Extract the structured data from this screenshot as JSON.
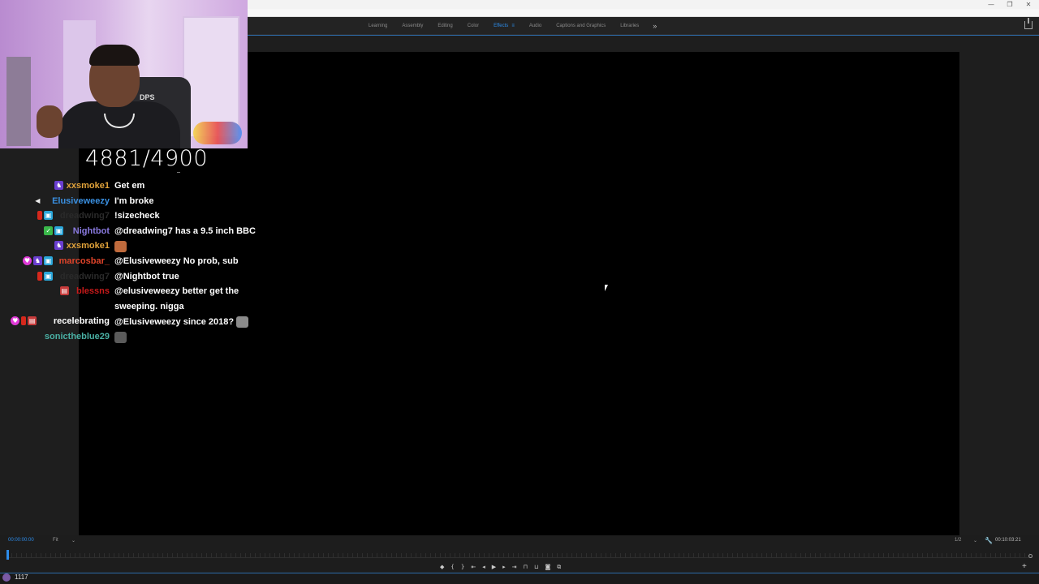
{
  "window": {
    "controls": {
      "minimize": "—",
      "maximize": "❐",
      "close": "✕"
    }
  },
  "workspace": {
    "tabs": [
      {
        "label": "Learning",
        "active": false
      },
      {
        "label": "Assembly",
        "active": false
      },
      {
        "label": "Editing",
        "active": false
      },
      {
        "label": "Color",
        "active": false
      },
      {
        "label": "Effects",
        "active": true
      },
      {
        "label": "Audio",
        "active": false
      },
      {
        "label": "Captions and Graphics",
        "active": false
      },
      {
        "label": "Libraries",
        "active": false
      }
    ],
    "menu_glyph": "≡",
    "more_glyph": "»"
  },
  "overlay": {
    "counter": "4881/4900"
  },
  "chat": {
    "messages": [
      {
        "user": "xxsmoke1",
        "color": "#e0a23a",
        "badges": [
          "purple"
        ],
        "text": "Get em",
        "emote": ""
      },
      {
        "user": "Elusiveweezy",
        "color": "#3a8fe0",
        "badges": [
          "mute"
        ],
        "text": "I'm broke",
        "emote": ""
      },
      {
        "user": "dreadwing7",
        "color": "#2a2a2a",
        "badges": [
          "red",
          "cyan"
        ],
        "text": "!sizecheck",
        "emote": ""
      },
      {
        "user": "Nightbot",
        "color": "#8a7ae0",
        "badges": [
          "green",
          "cyan"
        ],
        "text": "@dreadwing7 has a 9.5 inch BBC",
        "emote": ""
      },
      {
        "user": "xxsmoke1",
        "color": "#e0a23a",
        "badges": [
          "purple"
        ],
        "text": "",
        "emote": "a"
      },
      {
        "user": "marcosbar_",
        "color": "#e0442a",
        "badges": [
          "pink",
          "purple",
          "cyan"
        ],
        "text": "@Elusiveweezy No prob, sub",
        "emote": ""
      },
      {
        "user": "dreadwing7",
        "color": "#2a2a2a",
        "badges": [
          "red",
          "cyan"
        ],
        "text": "@Nightbot true",
        "emote": ""
      },
      {
        "user": "blessns",
        "color": "#c81a1a",
        "badges": [
          "gift"
        ],
        "text": "@elusiveweezy better get the",
        "emote": ""
      },
      {
        "user": "",
        "color": "#ffffff",
        "badges": [],
        "text": "sweeping. nigga",
        "emote": ""
      },
      {
        "user": "recelebrating",
        "color": "#ffffff",
        "badges": [
          "pink",
          "red",
          "gift"
        ],
        "text": "@Elusiveweezy since 2018?",
        "emote": "b"
      },
      {
        "user": "sonictheblue29",
        "color": "#4ab0a4",
        "badges": [],
        "text": "",
        "emote": "c"
      }
    ]
  },
  "program_monitor": {
    "timecode_in": "00:00:00:00",
    "fit": "Fit",
    "page": "1/2",
    "timecode_out": "00:10:03:21"
  },
  "transport": {
    "buttons": [
      "add-marker",
      "mark-in",
      "mark-out",
      "go-to-in",
      "step-back",
      "play",
      "step-forward",
      "go-to-out",
      "insert",
      "overwrite",
      "export-frame",
      "compare"
    ]
  },
  "status": {
    "viewer_count": "1117"
  }
}
